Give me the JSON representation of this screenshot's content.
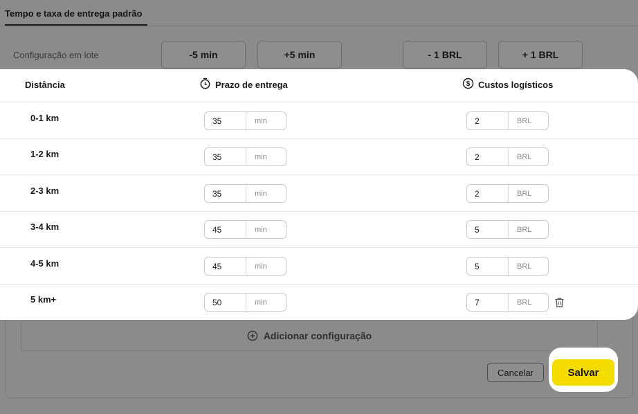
{
  "page_tab": "Tempo e taxa de entrega padrão",
  "batch": {
    "label": "Configuração em lote",
    "buttons": [
      "-5 min",
      "+5 min",
      "- 1 BRL",
      "+ 1 BRL"
    ]
  },
  "table": {
    "col_distance": "Distância",
    "col_time": "Prazo de entrega",
    "col_cost": "Custos logísticos",
    "time_unit": "min",
    "cost_unit": "BRL",
    "rows": [
      {
        "distance": "0-1 km",
        "time": "35",
        "cost": "2"
      },
      {
        "distance": "1-2 km",
        "time": "35",
        "cost": "2"
      },
      {
        "distance": "2-3 km",
        "time": "35",
        "cost": "2"
      },
      {
        "distance": "3-4 km",
        "time": "45",
        "cost": "5"
      },
      {
        "distance": "4-5 km",
        "time": "45",
        "cost": "5"
      },
      {
        "distance": "5 km+",
        "time": "50",
        "cost": "7"
      }
    ]
  },
  "add_config_label": "Adicionar configuração",
  "cancel_label": "Cancelar",
  "save_label": "Salvar",
  "icons": {
    "time": "timer-icon",
    "cost": "dollar-coin-icon",
    "add": "plus-circle-icon",
    "delete": "trash-icon"
  },
  "colors": {
    "accent": "#f5dc00",
    "overlay": "#8b8b8b"
  }
}
